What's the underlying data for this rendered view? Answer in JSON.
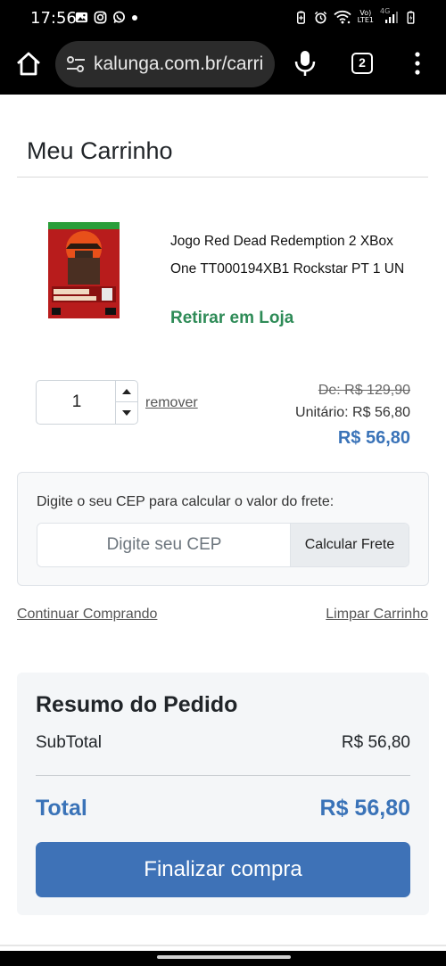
{
  "status_bar": {
    "time": "17:56",
    "left_icons": [
      "image-icon",
      "instagram-icon",
      "whatsapp-icon",
      "dot-icon"
    ],
    "right_icons": [
      "battery-saver-icon",
      "alarm-icon",
      "wifi-icon",
      "volte-icon",
      "signal-icon",
      "battery-icon"
    ],
    "network_vo": "Vo)",
    "network_lte": "LTE1",
    "network_4g": "4G"
  },
  "browser": {
    "url": "kalunga.com.br/carri",
    "tab_count": "2",
    "icons": [
      "home-icon",
      "site-settings-icon",
      "mic-icon",
      "tabs-icon",
      "more-vert-icon"
    ]
  },
  "page": {
    "title": "Meu Carrinho"
  },
  "cart_item": {
    "name": "Jogo Red Dead Redemption 2 XBox One TT000194XB1 Rockstar PT 1 UN",
    "pickup": "Retirar em Loja",
    "quantity": "1",
    "remove_label": "remover",
    "price_old": "De: R$ 129,90",
    "price_unit": "Unitário: R$ 56,80",
    "price_total": "R$ 56,80"
  },
  "shipping": {
    "label": "Digite o seu CEP para calcular o valor do frete:",
    "placeholder": "Digite seu CEP",
    "button": "Calcular Frete"
  },
  "links": {
    "continue": "Continuar Comprando",
    "clear": "Limpar Carrinho"
  },
  "summary": {
    "title": "Resumo do Pedido",
    "subtotal_label": "SubTotal",
    "subtotal_value": "R$ 56,80",
    "total_label": "Total",
    "total_value": "R$ 56,80",
    "checkout": "Finalizar compra"
  },
  "colors": {
    "accent_blue": "#3e72b7",
    "pickup_green": "#2e8b57"
  }
}
